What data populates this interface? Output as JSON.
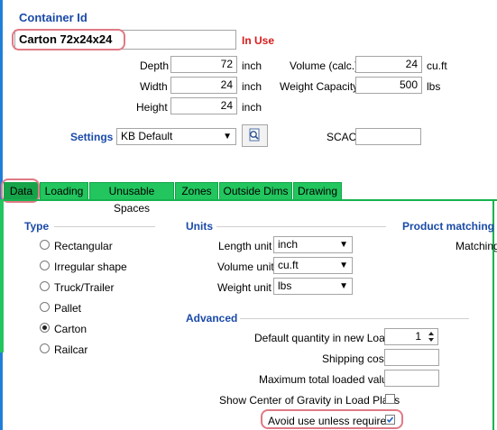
{
  "header": {
    "title": "Container Id",
    "name_value": "Carton 72x24x24",
    "status": "In Use"
  },
  "dims": {
    "depth_label": "Depth",
    "depth_value": "72",
    "depth_unit": "inch",
    "width_label": "Width",
    "width_value": "24",
    "width_unit": "inch",
    "height_label": "Height",
    "height_value": "24",
    "height_unit": "inch",
    "volume_label": "Volume (calc.)",
    "volume_value": "24",
    "volume_unit": "cu.ft",
    "weight_label": "Weight Capacity",
    "weight_value": "500",
    "weight_unit": "lbs"
  },
  "settings": {
    "label": "Settings",
    "value": "KB Default",
    "scac_label": "SCAC",
    "scac_value": ""
  },
  "tabs": [
    "Data",
    "Loading",
    "Unusable Spaces",
    "Zones",
    "Outside Dims",
    "Drawing"
  ],
  "type_section": {
    "title": "Type",
    "options": [
      "Rectangular",
      "Irregular shape",
      "Truck/Trailer",
      "Pallet",
      "Carton",
      "Railcar"
    ],
    "selected": "Carton"
  },
  "units_section": {
    "title": "Units",
    "length_label": "Length unit",
    "length_value": "inch",
    "volume_label": "Volume unit",
    "volume_value": "cu.ft",
    "weight_label": "Weight unit",
    "weight_value": "lbs"
  },
  "product_matching": {
    "title": "Product matching",
    "matching_label": "Matching"
  },
  "advanced": {
    "title": "Advanced",
    "default_qty_label": "Default quantity in new Load",
    "default_qty_value": "1",
    "shipping_cost_label": "Shipping cost",
    "shipping_cost_value": "",
    "max_loaded_label": "Maximum total loaded value",
    "max_loaded_value": "",
    "cog_label": "Show Center of Gravity in Load Plans",
    "cog_checked": false,
    "avoid_label": "Avoid use unless required",
    "avoid_checked": true
  },
  "colors": {
    "accent_blue": "#1a4aa8",
    "tab_green": "#22c55e",
    "status_red": "#d81b1b",
    "highlight_pink": "#e07a86"
  }
}
